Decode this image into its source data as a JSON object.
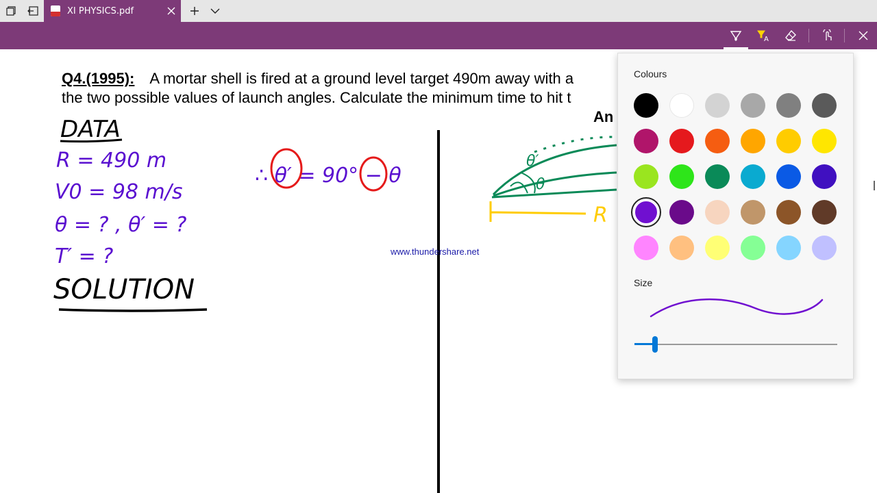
{
  "tab": {
    "title": "XI PHYSICS.pdf"
  },
  "document": {
    "question_label": "Q4.(1995):",
    "question_line1": "A mortar shell is fired at a ground level target 490m away with a",
    "question_line2": "the two possible values of launch angles. Calculate the minimum time to hit t",
    "answer_label": "An",
    "watermark": "www.thundershare.net",
    "handwriting": {
      "heading_data": "DATA",
      "range": "R = 490 m",
      "velocity": "V0 = 98 m/s",
      "angles": "θ = ? , θ′ = ?",
      "time": "T′ = ?",
      "heading_solution": "SOLUTION",
      "relation": "∴ θ′ = 90° − θ",
      "diagram_theta1": "θ′",
      "diagram_theta2": "θ",
      "diagram_range": "R"
    }
  },
  "palette": {
    "colours_title": "Colours",
    "size_title": "Size",
    "selected_colour": "#7010d0",
    "slider_value": 0.1,
    "colors": [
      "#000000",
      "#ffffff",
      "#d3d3d3",
      "#a8a8a8",
      "#808080",
      "#5a5a5a",
      "#b0156a",
      "#e5191d",
      "#f55d11",
      "#ffa600",
      "#ffcc00",
      "#ffe600",
      "#9ae51f",
      "#2ee51a",
      "#0a8a58",
      "#0aaad0",
      "#0a5ae5",
      "#4010c0",
      "#7010d0",
      "#6a0a8a",
      "#f7d5bf",
      "#c0966a",
      "#8c5528",
      "#603a28",
      "#ff85ff",
      "#ffc080",
      "#ffff75",
      "#85ff95",
      "#85d5ff",
      "#c0c0ff"
    ]
  },
  "icons": {
    "restore_tabs": "tab-restore-icon",
    "back_tabs": "tab-back-icon",
    "new_tab": "plus-icon",
    "tab_list": "chevron-down-icon",
    "draw": "pen-icon",
    "highlight": "highlighter-icon",
    "erase": "eraser-icon",
    "touch": "touch-writing-icon",
    "close": "close-icon"
  }
}
